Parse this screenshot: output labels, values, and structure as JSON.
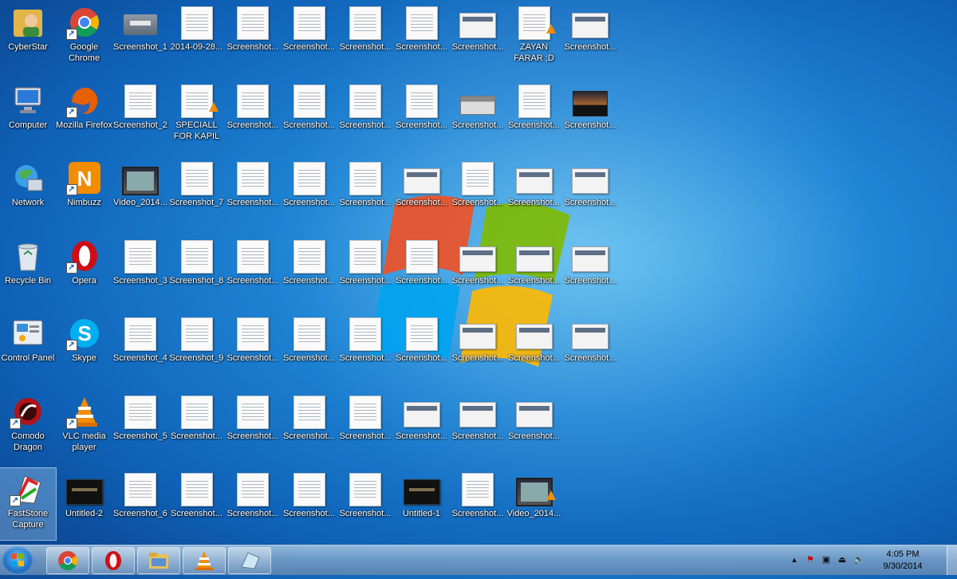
{
  "desktop": {
    "columns": [
      [
        {
          "label": "CyberStar",
          "kind": "app-user"
        },
        {
          "label": "Computer",
          "kind": "app-computer"
        },
        {
          "label": "Network",
          "kind": "app-network"
        },
        {
          "label": "Recycle Bin",
          "kind": "app-recycle"
        },
        {
          "label": "Control Panel",
          "kind": "app-control"
        },
        {
          "label": "Comodo Dragon",
          "kind": "app-comodo"
        },
        {
          "label": "FastStone Capture",
          "kind": "app-faststone",
          "selected": true
        }
      ],
      [
        {
          "label": "Google Chrome",
          "kind": "app-chrome"
        },
        {
          "label": "Mozilla Firefox",
          "kind": "app-firefox"
        },
        {
          "label": "Nimbuzz",
          "kind": "app-nimbuzz"
        },
        {
          "label": "Opera",
          "kind": "app-opera"
        },
        {
          "label": "Skype",
          "kind": "app-skype"
        },
        {
          "label": "VLC media player",
          "kind": "app-vlc"
        },
        {
          "label": "Untitled-2",
          "kind": "dark"
        }
      ],
      [
        {
          "label": "Screenshot_1",
          "kind": "folder"
        },
        {
          "label": "Screenshot_2",
          "kind": "doc"
        },
        {
          "label": "Video_2014...",
          "kind": "vid"
        },
        {
          "label": "Screenshot_3",
          "kind": "doc"
        },
        {
          "label": "Screenshot_4",
          "kind": "doc"
        },
        {
          "label": "Screenshot_5",
          "kind": "doc"
        },
        {
          "label": "Screenshot_6",
          "kind": "doc"
        }
      ],
      [
        {
          "label": "2014-09-28...",
          "kind": "doc"
        },
        {
          "label": "SPECIALL FOR KAPIL",
          "kind": "doc-vlc"
        },
        {
          "label": "Screenshot_7",
          "kind": "doc"
        },
        {
          "label": "Screenshot_8",
          "kind": "doc"
        },
        {
          "label": "Screenshot_9",
          "kind": "doc"
        },
        {
          "label": "Screenshot...",
          "kind": "doc"
        },
        {
          "label": "Screenshot...",
          "kind": "doc"
        }
      ],
      [
        {
          "label": "Screenshot...",
          "kind": "doc"
        },
        {
          "label": "Screenshot...",
          "kind": "doc"
        },
        {
          "label": "Screenshot...",
          "kind": "doc"
        },
        {
          "label": "Screenshot...",
          "kind": "doc"
        },
        {
          "label": "Screenshot...",
          "kind": "doc"
        },
        {
          "label": "Screenshot...",
          "kind": "doc"
        },
        {
          "label": "Screenshot...",
          "kind": "doc"
        }
      ],
      [
        {
          "label": "Screenshot...",
          "kind": "doc"
        },
        {
          "label": "Screenshot...",
          "kind": "doc"
        },
        {
          "label": "Screenshot...",
          "kind": "doc"
        },
        {
          "label": "Screenshot...",
          "kind": "doc"
        },
        {
          "label": "Screenshot...",
          "kind": "doc"
        },
        {
          "label": "Screenshot...",
          "kind": "doc"
        },
        {
          "label": "Screenshot...",
          "kind": "doc"
        }
      ],
      [
        {
          "label": "Screenshot...",
          "kind": "doc"
        },
        {
          "label": "Screenshot...",
          "kind": "doc"
        },
        {
          "label": "Screenshot...",
          "kind": "doc"
        },
        {
          "label": "Screenshot...",
          "kind": "doc"
        },
        {
          "label": "Screenshot...",
          "kind": "doc"
        },
        {
          "label": "Screenshot...",
          "kind": "doc"
        },
        {
          "label": "Screenshot...",
          "kind": "doc"
        }
      ],
      [
        {
          "label": "Screenshot...",
          "kind": "doc"
        },
        {
          "label": "Screenshot...",
          "kind": "doc"
        },
        {
          "label": "Screenshot...",
          "kind": "wide"
        },
        {
          "label": "Screenshot...",
          "kind": "doc"
        },
        {
          "label": "Screenshot...",
          "kind": "doc"
        },
        {
          "label": "Screenshot...",
          "kind": "wide"
        },
        {
          "label": "Untitled-1",
          "kind": "dark"
        }
      ],
      [
        {
          "label": "Screenshot...",
          "kind": "wide"
        },
        {
          "label": "Screenshot...",
          "kind": "gray"
        },
        {
          "label": "Screenshot...",
          "kind": "doc"
        },
        {
          "label": "Screenshot...",
          "kind": "wide"
        },
        {
          "label": "Screenshot...",
          "kind": "wide"
        },
        {
          "label": "Screenshot...",
          "kind": "wide"
        },
        {
          "label": "Screenshot...",
          "kind": "doc"
        }
      ],
      [
        {
          "label": "ZAYAN FARAR ;D",
          "kind": "doc-vlc"
        },
        {
          "label": "Screenshot...",
          "kind": "doc"
        },
        {
          "label": "Screenshot...",
          "kind": "wide"
        },
        {
          "label": "Screenshot...",
          "kind": "wide"
        },
        {
          "label": "Screenshot...",
          "kind": "wide"
        },
        {
          "label": "Screenshot...",
          "kind": "wide"
        },
        {
          "label": "Video_2014...",
          "kind": "vid-vlc"
        }
      ],
      [
        {
          "label": "Screenshot...",
          "kind": "wide"
        },
        {
          "label": "Screenshot...",
          "kind": "sunset"
        },
        {
          "label": "Screenshot...",
          "kind": "wide"
        },
        {
          "label": "Screenshot...",
          "kind": "wide"
        },
        {
          "label": "Screenshot...",
          "kind": "wide"
        }
      ]
    ]
  },
  "taskbar": {
    "pinned": [
      {
        "name": "chrome-taskbar-button",
        "icon": "chrome-icon"
      },
      {
        "name": "opera-taskbar-button",
        "icon": "opera-icon"
      },
      {
        "name": "explorer-taskbar-button",
        "icon": "folder-icon"
      },
      {
        "name": "vlc-taskbar-button",
        "icon": "vlc-icon"
      },
      {
        "name": "faststone-taskbar-button",
        "icon": "faststone-icon"
      }
    ],
    "clock": {
      "time": "4:05 PM",
      "date": "9/30/2014"
    }
  },
  "colors": {
    "wallpaper": "#1f86d6",
    "taskbar": "#6f9cc8",
    "chrome_red": "#db4437",
    "opera_red": "#cc0f16",
    "vlc_orange": "#f28c00"
  }
}
